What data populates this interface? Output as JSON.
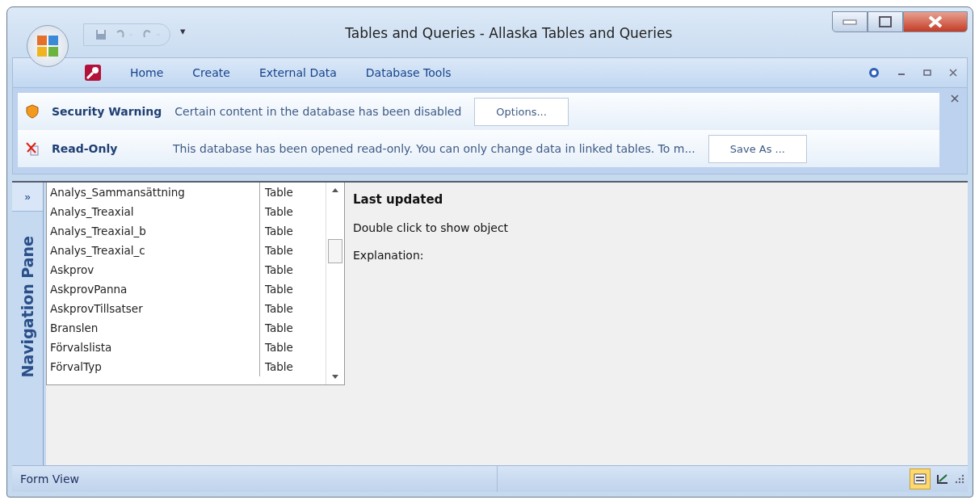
{
  "window": {
    "title": "Tables and Queries - Allaska Tables and Queries",
    "quick_access_more": "▾"
  },
  "ribbon_tabs": [
    {
      "label": "Home",
      "selected": false
    },
    {
      "label": "Create",
      "selected": false
    },
    {
      "label": "External Data",
      "selected": false
    },
    {
      "label": "Database Tools",
      "selected": false
    }
  ],
  "message_bar": [
    {
      "kind": "security",
      "title": "Security Warning",
      "text": "Certain content in the database has been disabled",
      "button": "Options..."
    },
    {
      "kind": "readonly",
      "title": "Read-Only",
      "text": "This database has been opened read-only. You can only change data in linked tables. To m...",
      "button": "Save As ..."
    }
  ],
  "navigation_pane": {
    "title": "Navigation Pane",
    "toggle": "»"
  },
  "object_list": [
    {
      "name": "Analys_Sammansättning",
      "type": "Table"
    },
    {
      "name": "Analys_Treaxial",
      "type": "Table"
    },
    {
      "name": "Analys_Treaxial_b",
      "type": "Table"
    },
    {
      "name": "Analys_Treaxial_c",
      "type": "Table"
    },
    {
      "name": "Askprov",
      "type": "Table"
    },
    {
      "name": "AskprovPanna",
      "type": "Table"
    },
    {
      "name": "AskprovTillsatser",
      "type": "Table"
    },
    {
      "name": "Branslen",
      "type": "Table"
    },
    {
      "name": "Förvalslista",
      "type": "Table"
    },
    {
      "name": "FörvalTyp",
      "type": "Table"
    }
  ],
  "details": {
    "heading": "Last updated",
    "hint": "Double click to show object",
    "explanation_label": "Explanation:"
  },
  "status_bar": {
    "text": "Form View",
    "view_buttons": [
      {
        "kind": "form",
        "selected": true
      },
      {
        "kind": "design",
        "selected": false
      }
    ]
  }
}
